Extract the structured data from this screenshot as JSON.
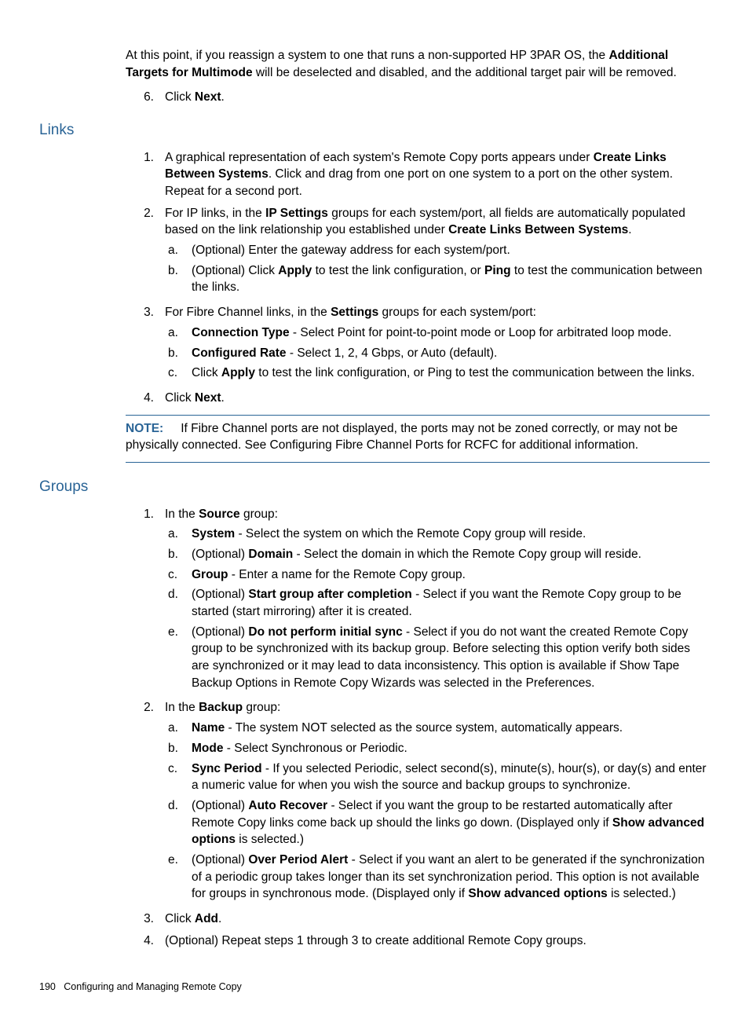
{
  "intro": {
    "para": "At this point, if you reassign a system to one that runs a non-supported HP 3PAR OS, the ",
    "bold": "Additional Targets for Multimode",
    "rest": " will be deselected and disabled, and the additional target pair will be removed."
  },
  "step6_click": "Click ",
  "step6_next": "Next",
  "period": ".",
  "links": {
    "heading": "Links",
    "s1a": "A graphical representation of each system's Remote Copy ports appears under ",
    "s1b": "Create Links Between Systems",
    "s1c": ". Click and drag from one port on one system to a port on the other system. Repeat for a second port.",
    "s2a": "For IP links, in the ",
    "s2b": "IP Settings",
    "s2c": " groups for each system/port, all fields are automatically populated based on the link relationship you established under ",
    "s2d": "Create Links Between Systems",
    "s2e": ".",
    "s2_a": "(Optional) Enter the gateway address for each system/port.",
    "s2_b_pre": "(Optional) Click ",
    "s2_b_apply": "Apply",
    "s2_b_mid": " to test the link configuration, or ",
    "s2_b_ping": "Ping",
    "s2_b_post": " to test the communication between the links.",
    "s3a": "For Fibre Channel links, in the ",
    "s3b": "Settings",
    "s3c": " groups for each system/port:",
    "s3_a_b": "Connection Type",
    "s3_a_t": " - Select Point for point-to-point mode or Loop for arbitrated loop mode.",
    "s3_b_b": "Configured Rate",
    "s3_b_t": " - Select 1, 2, 4 Gbps, or Auto (default).",
    "s3_c_pre": "Click ",
    "s3_c_apply": "Apply",
    "s3_c_post": " to test the link configuration, or Ping to test the communication between the links.",
    "s4_click": "Click ",
    "s4_next": "Next",
    "note_label": "NOTE:",
    "note_text": "If Fibre Channel ports are not displayed, the ports may not be zoned correctly, or may not be physically connected. See Configuring Fibre Channel Ports for RCFC for additional information."
  },
  "groups": {
    "heading": "Groups",
    "s1_pre": "In the ",
    "s1_b": "Source",
    "s1_post": " group:",
    "s1a_b": "System",
    "s1a_t": " - Select the system on which the Remote Copy group will reside.",
    "s1b_pre": "(Optional) ",
    "s1b_b": "Domain",
    "s1b_t": " - Select the domain in which the Remote Copy group will reside.",
    "s1c_b": "Group",
    "s1c_t": " - Enter a name for the Remote Copy group.",
    "s1d_pre": "(Optional) ",
    "s1d_b": "Start group after completion",
    "s1d_t": " - Select if you want the Remote Copy group to be started (start mirroring) after it is created.",
    "s1e_pre": "(Optional) ",
    "s1e_b": "Do not perform initial sync",
    "s1e_t": " - Select if you do not want the created Remote Copy group to be synchronized with its backup group. Before selecting this option verify both sides are synchronized or it may lead to data inconsistency. This option is available if Show Tape Backup Options in Remote Copy Wizards was selected in the Preferences.",
    "s2_pre": "In the ",
    "s2_b": "Backup",
    "s2_post": " group:",
    "s2a_b": "Name",
    "s2a_t": " - The system NOT selected as the source system, automatically appears.",
    "s2b_b": "Mode",
    "s2b_t": " - Select Synchronous or Periodic.",
    "s2c_b": "Sync Period",
    "s2c_t": " - If you selected Periodic, select second(s), minute(s), hour(s), or day(s) and enter a numeric value for when you wish the source and backup groups to synchronize.",
    "s2d_pre": "(Optional) ",
    "s2d_b": "Auto Recover",
    "s2d_t": " - Select if you want the group to be restarted automatically after Remote Copy links come back up should the links go down. (Displayed only if ",
    "s2d_b2": "Show advanced options",
    "s2d_t2": " is selected.)",
    "s2e_pre": "(Optional) ",
    "s2e_b": "Over Period Alert",
    "s2e_t": " - Select if you want an alert to be generated if the synchronization of a periodic group takes longer than its set synchronization period. This option is not available for groups in synchronous mode. (Displayed only if ",
    "s2e_b2": "Show advanced options",
    "s2e_t2": " is selected.)",
    "s3_click": "Click ",
    "s3_add": "Add",
    "s4": "(Optional) Repeat steps 1 through 3 to create additional Remote Copy groups."
  },
  "footer": {
    "page": "190",
    "title": "Configuring and Managing Remote Copy"
  },
  "markers": {
    "n1": "1.",
    "n2": "2.",
    "n3": "3.",
    "n4": "4.",
    "n6": "6.",
    "a": "a.",
    "b": "b.",
    "c": "c.",
    "d": "d.",
    "e": "e."
  }
}
